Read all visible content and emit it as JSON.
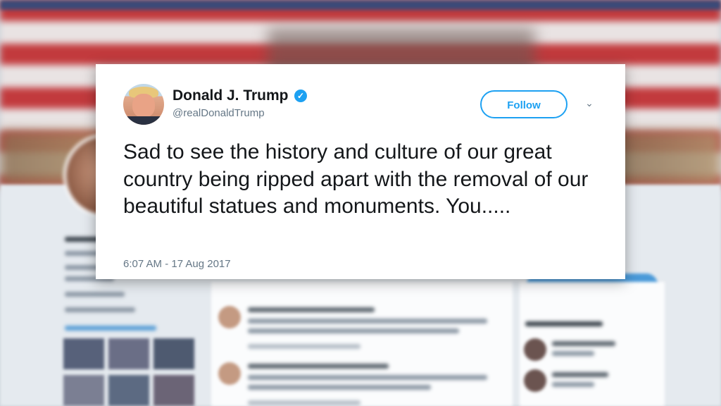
{
  "tweet": {
    "author_name": "Donald J. Trump",
    "verified_mark": "✓",
    "handle": "@realDonaldTrump",
    "follow_label": "Follow",
    "menu_icon": "chevron-down-icon",
    "menu_glyph": "⌄",
    "text": "Sad to see the history and culture of our great country being ripped apart with the removal of our beautiful statues and monuments. You.....",
    "timestamp": "6:07 AM - 17 Aug 2017"
  },
  "colors": {
    "accent": "#1da1f2",
    "text_primary": "#14171a",
    "text_secondary": "#657786"
  }
}
